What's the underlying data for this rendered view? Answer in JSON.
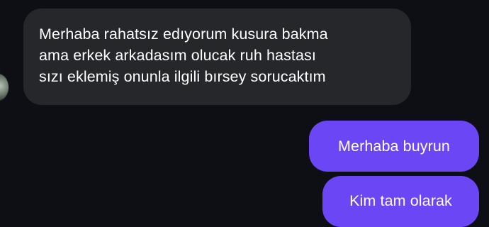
{
  "conversation": {
    "messages": [
      {
        "direction": "received",
        "text": "Merhaba rahatsız edıyorum kusura bakma\nama erkek arkadasım olucak ruh hastası\nsızı eklemiş onunla ilgili bırsey sorucaktım"
      },
      {
        "direction": "sent",
        "text": "Merhaba buyrun"
      },
      {
        "direction": "sent",
        "text": "Kim tam olarak"
      }
    ]
  },
  "colors": {
    "background": "#0d0f15",
    "received_bubble": "#26272b",
    "sent_bubble": "#6b46f5",
    "text": "#ffffff"
  }
}
